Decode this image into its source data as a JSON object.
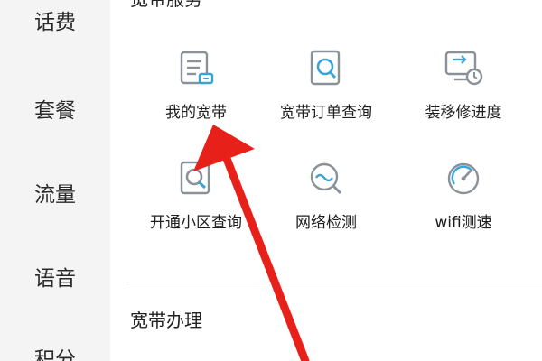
{
  "sidebar": {
    "items": [
      {
        "label": "话费"
      },
      {
        "label": "套餐"
      },
      {
        "label": "流量"
      },
      {
        "label": "语音"
      },
      {
        "label": "积分"
      }
    ]
  },
  "sections": {
    "broadband_service": {
      "title": "宽带服务"
    },
    "broadband_apply": {
      "title": "宽带办理"
    }
  },
  "tiles": [
    {
      "label": "我的宽带",
      "icon": "broadband-card-icon"
    },
    {
      "label": "宽带订单查询",
      "icon": "order-search-icon"
    },
    {
      "label": "装移修进度",
      "icon": "install-progress-icon"
    },
    {
      "label": "开通小区查询",
      "icon": "area-search-icon"
    },
    {
      "label": "网络检测",
      "icon": "network-check-icon"
    },
    {
      "label": "wifi测速",
      "icon": "speedometer-icon"
    }
  ],
  "colors": {
    "sidebar_bg": "#f4f4f4",
    "icon_stroke": "#8a9199",
    "icon_accent": "#3aa3d8",
    "annotation_arrow": "#e8201a"
  }
}
